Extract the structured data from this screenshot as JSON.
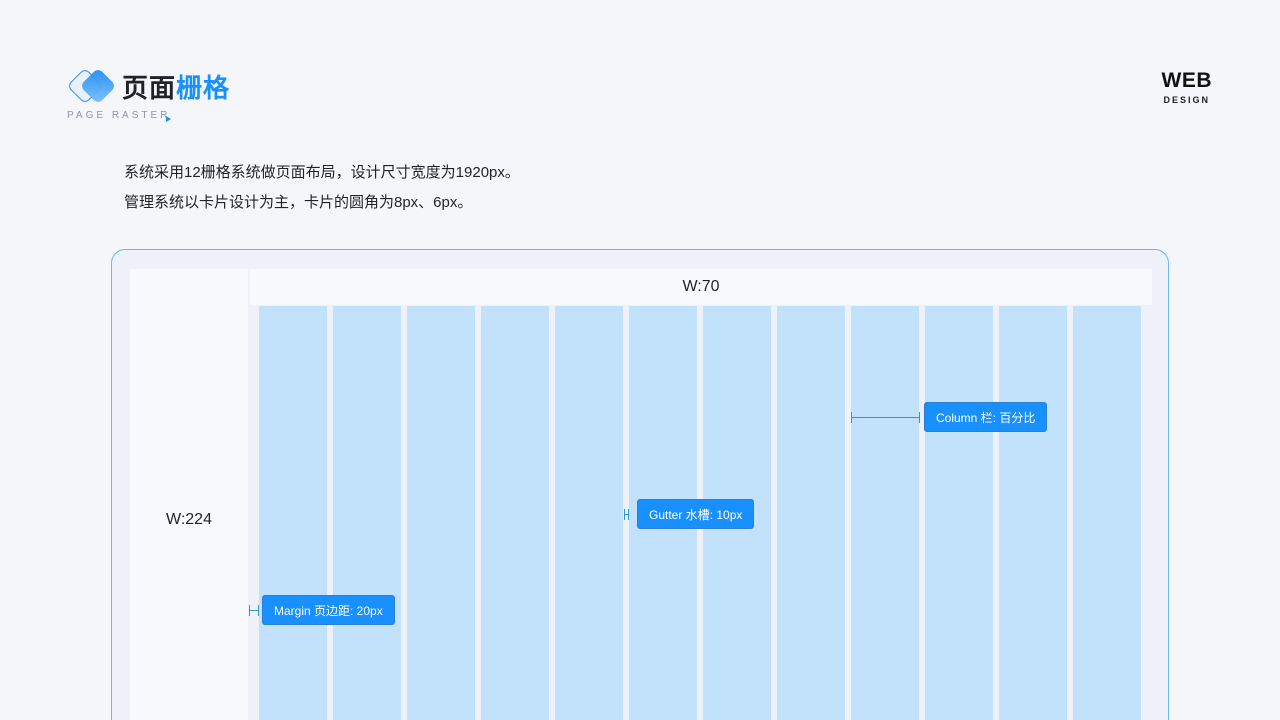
{
  "header": {
    "title_part1": "页面",
    "title_part2": "栅格",
    "subtitle": "PAGE RASTER",
    "brand_main": "WEB",
    "brand_sub": "DESIGN"
  },
  "description": {
    "line1": "系统采用12栅格系统做页面布局，设计尺寸宽度为1920px。",
    "line2": "管理系统以卡片设计为主，卡片的圆角为8px、6px。"
  },
  "grid": {
    "sidebar_label": "W:224",
    "header_label": "W:70",
    "column_count": 12,
    "column_color": "#c2e1fa",
    "accent_color": "#1890ff"
  },
  "annotations": {
    "column": "Column 栏: 百分比",
    "gutter": "Gutter 水槽: 10px",
    "margin": "Margin 页边距: 20px"
  }
}
